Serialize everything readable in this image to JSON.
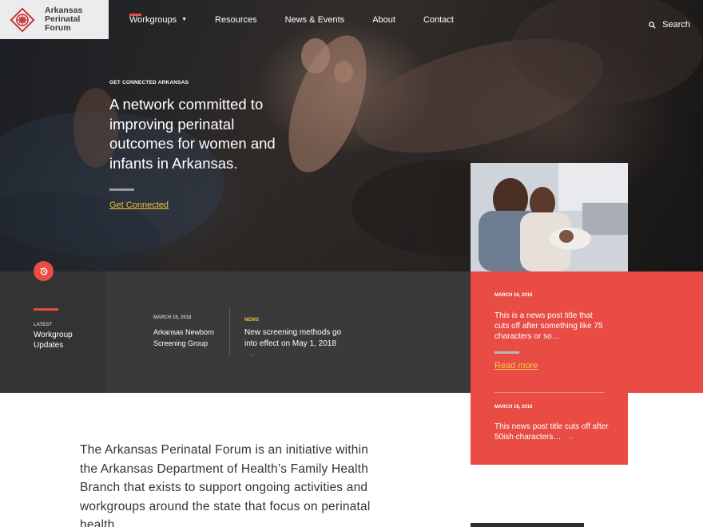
{
  "header": {
    "logo_lines": [
      "Arkansas",
      "Perinatal",
      "Forum"
    ],
    "nav": [
      {
        "label": "Workgroups",
        "has_caret": true,
        "active": true
      },
      {
        "label": "Resources"
      },
      {
        "label": "News & Events"
      },
      {
        "label": "About"
      },
      {
        "label": "Contact"
      }
    ],
    "search_label": "Search"
  },
  "hero": {
    "eyebrow": "GET CONNECTED ARKANSAS",
    "title": "A network committed to improving perinatal outcomes for women and infants in Arkansas.",
    "cta": "Get Connected"
  },
  "latest": {
    "label": "LATEST",
    "title": "Workgroup Updates",
    "item1": {
      "date": "MARCH 16, 2018",
      "title": "Arkansas Newborn Screening Group"
    },
    "item2": {
      "tag": "NEWS",
      "title": "New screening methods go into effect on May 1, 2018",
      "arrow": "→"
    }
  },
  "news_panel": {
    "item1": {
      "date": "MARCH 16, 2018",
      "title": "This is a news post title that cuts off after something like 75 characters or so…",
      "link": "Read more"
    },
    "item2": {
      "date": "MARCH 16, 2018",
      "title": "This news post title cuts off after 50ish characters…",
      "arrow": "→"
    }
  },
  "intro": "The Arkansas Perinatal Forum is an initiative within the Arkansas Department of Health’s Family Health Branch that exists to support ongoing activities and workgroups around the state that focus on perinatal health.",
  "colors": {
    "accent": "#e84c45",
    "gold": "#f0c23c",
    "dark": "#3a3a3a"
  }
}
